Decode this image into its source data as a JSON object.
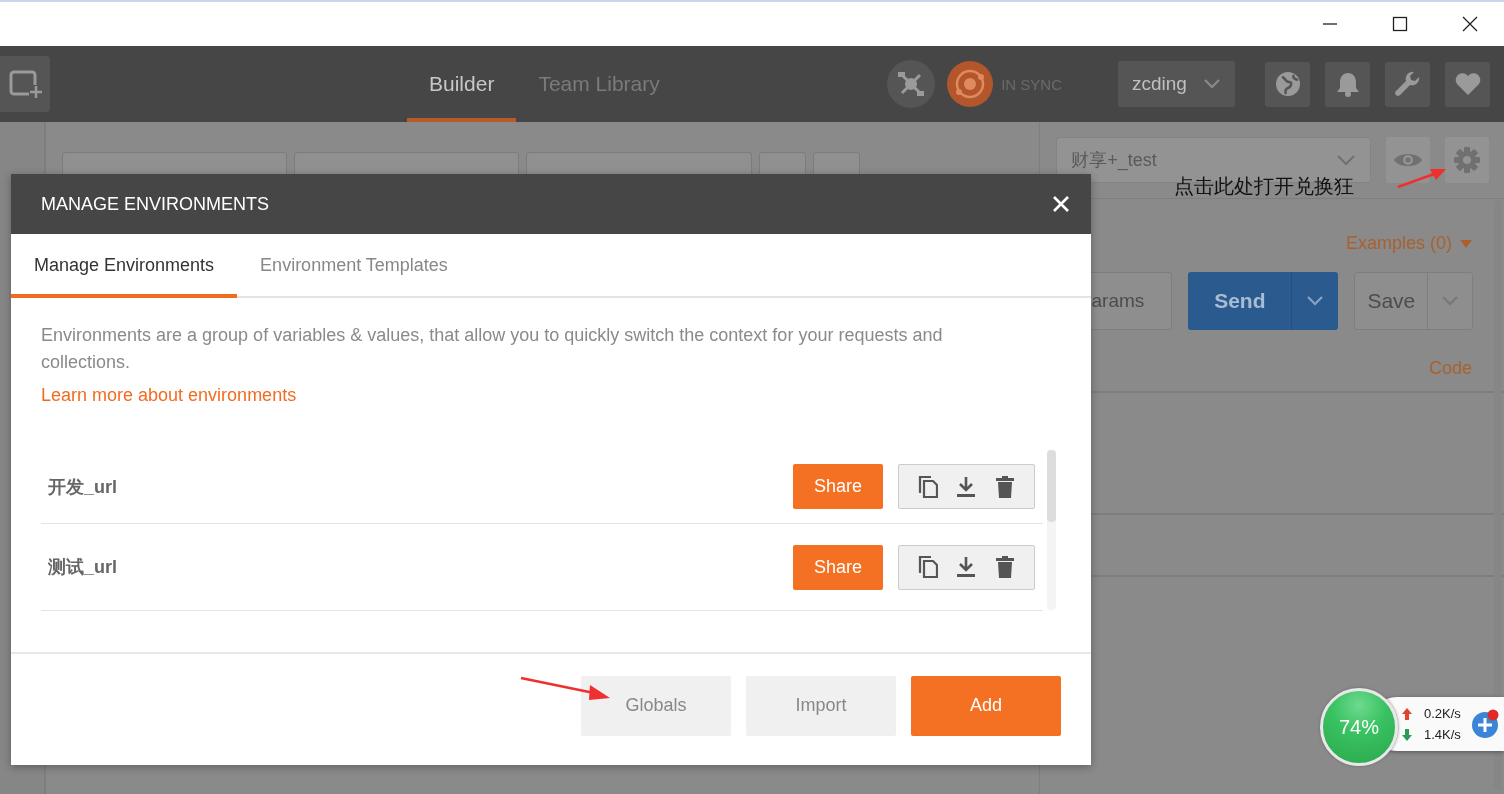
{
  "header": {
    "tabs": [
      {
        "label": "Builder",
        "selected": true
      },
      {
        "label": "Team Library",
        "selected": false
      }
    ],
    "sync_status": "IN SYNC",
    "user": "zcding"
  },
  "environment_selector": {
    "value": "财享+_test"
  },
  "request": {
    "examples": "Examples (0)",
    "params_button": "arams",
    "send": "Send",
    "save": "Save",
    "code": "Code"
  },
  "annotation": {
    "text": "点击此处打开兑换狂"
  },
  "modal": {
    "title": "MANAGE ENVIRONMENTS",
    "tabs": [
      {
        "label": "Manage Environments",
        "selected": true
      },
      {
        "label": "Environment Templates",
        "selected": false
      }
    ],
    "description": "Environments are a group of variables & values, that allow you to quickly switch the context for your requests and collections.",
    "link": "Learn more about environments",
    "environments": [
      {
        "name": "开发_url",
        "share": "Share"
      },
      {
        "name": "测试_url",
        "share": "Share"
      }
    ],
    "buttons": [
      {
        "label": "Globals",
        "kind": "secondary"
      },
      {
        "label": "Import",
        "kind": "secondary"
      },
      {
        "label": "Add",
        "kind": "primary"
      }
    ]
  },
  "network_widget": {
    "percent": "74%",
    "upload": "0.2K/s",
    "download": "1.4K/s"
  }
}
